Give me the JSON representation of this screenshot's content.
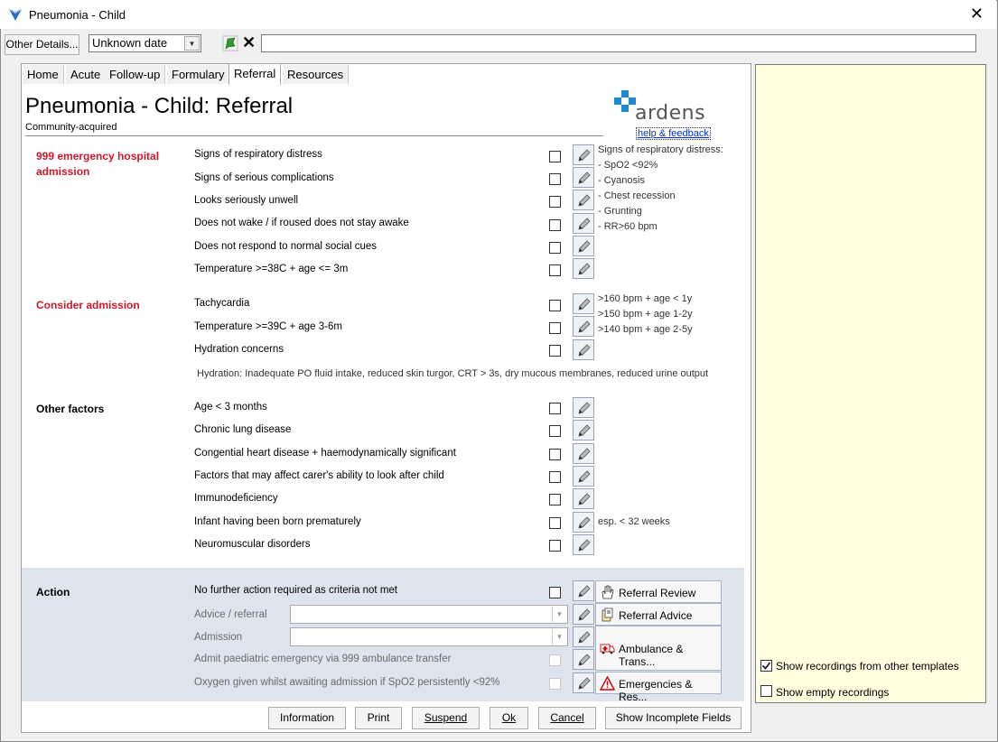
{
  "window": {
    "title": "Pneumonia - Child",
    "close_glyph": "✕"
  },
  "toolbar": {
    "other_details_label": "Other Details...",
    "date_value": "Unknown date",
    "confirm_icon": "green-flag-icon",
    "cancel_glyph": "✕",
    "free_text_value": ""
  },
  "tabs": [
    {
      "label": "Home"
    },
    {
      "label": "Acute"
    },
    {
      "label": "Follow-up"
    },
    {
      "label": "Formulary"
    },
    {
      "label": "Referral"
    },
    {
      "label": "Resources"
    }
  ],
  "active_tab": "Referral",
  "page": {
    "title": "Pneumonia - Child: Referral",
    "subtitle": "Community-acquired",
    "logo_text": "ardens",
    "help_link": "help & feedback"
  },
  "sections": {
    "emergency": {
      "label": "999 emergency hospital admission",
      "items": [
        "Signs of respiratory distress",
        "Signs of serious complications",
        "Looks seriously unwell",
        "Does not wake / if roused does not stay awake",
        "Does not respond to normal social cues",
        "Temperature >=38C + age <= 3m"
      ],
      "notes": [
        "Signs of respiratory distress:",
        "- SpO2 <92%",
        "- Cyanosis",
        "- Chest recession",
        "- Grunting",
        "- RR>60 bpm"
      ]
    },
    "consider": {
      "label": "Consider admission",
      "items": [
        "Tachycardia",
        "Temperature >=39C + age 3-6m",
        "Hydration concerns"
      ],
      "notes": [
        ">160 bpm + age < 1y",
        ">150 bpm + age 1-2y",
        ">140 bpm + age 2-5y"
      ],
      "hydration_note": "Hydration: Inadequate PO fluid intake, reduced skin turgor, CRT > 3s, dry mucous membranes, reduced urine output"
    },
    "other": {
      "label": "Other factors",
      "items": [
        "Age < 3 months",
        "Chronic lung disease",
        "Congential heart disease + haemodynamically significant",
        "Factors that may affect carer's ability to look after child",
        "Immunodeficiency",
        "Infant having been born prematurely",
        "Neuromuscular disorders"
      ],
      "premature_note": "esp. < 32 weeks"
    },
    "action": {
      "label": "Action",
      "no_further": "No further action required as criteria not met",
      "advice_label": "Advice / referral",
      "admission_label": "Admission",
      "admit_999": "Admit paediatric emergency via 999 ambulance transfer",
      "oxygen": "Oxygen given whilst awaiting admission if SpO2 persistently <92%",
      "buttons": {
        "referral_review": "Referral Review",
        "referral_advice": "Referral Advice",
        "ambulance": "Ambulance & Trans...",
        "emergencies": "Emergencies & Res..."
      }
    }
  },
  "bottom_buttons": {
    "information": "Information",
    "print": "Print",
    "suspend": "Suspend",
    "ok": "Ok",
    "cancel": "Cancel",
    "show_incomplete": "Show Incomplete Fields"
  },
  "right_pane": {
    "show_other_templates": "Show recordings from other templates",
    "show_other_templates_checked": true,
    "show_empty": "Show empty recordings",
    "show_empty_checked": false
  },
  "colors": {
    "section_red": "#d0182b",
    "logo_blue": "#1e8ad6",
    "action_bg": "#dde4ee",
    "right_pane_bg": "#ffffe0"
  }
}
